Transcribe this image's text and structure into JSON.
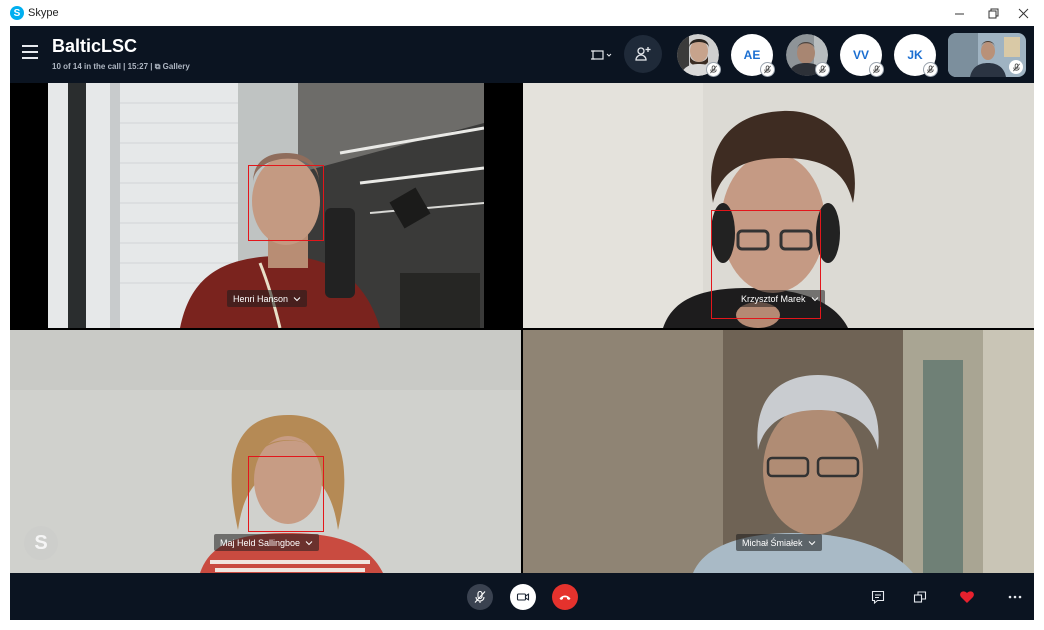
{
  "window": {
    "app_icon_letter": "S",
    "app_name": "Skype",
    "minimize_icon": "minimize-icon",
    "restore_icon": "restore-icon",
    "close_icon": "close-icon"
  },
  "call": {
    "title": "BalticLSC",
    "subtitle": "10 of 14 in the call | 15:27 | ⧉ Gallery",
    "participants": [
      {
        "type": "photo",
        "initials": "",
        "muted": true
      },
      {
        "type": "initials",
        "initials": "AE",
        "muted": true
      },
      {
        "type": "photo",
        "initials": "",
        "muted": true
      },
      {
        "type": "initials",
        "initials": "VV",
        "muted": true
      },
      {
        "type": "initials",
        "initials": "JK",
        "muted": true
      }
    ],
    "self_view_muted": true
  },
  "tiles": [
    {
      "name": "Henri Hanson"
    },
    {
      "name": "Krzysztof Marek"
    },
    {
      "name": "Maj Held Sallingboe"
    },
    {
      "name": "Michał Śmiałek"
    }
  ],
  "watermark": "S",
  "colors": {
    "header_bg": "#0b1421",
    "avatar_bg": "#ffffff",
    "avatar_text": "#1c6fd1",
    "end_call": "#e5322d",
    "heart": "#e8212e",
    "face_box": "#e3161b"
  },
  "controls": {
    "mute_icon": "microphone-muted-icon",
    "video_icon": "video-camera-icon",
    "end_call_icon": "hang-up-icon",
    "chat_icon": "chat-icon",
    "popout_icon": "popout-icon",
    "reaction_icon": "heart-icon",
    "more_icon": "more-options-icon"
  }
}
